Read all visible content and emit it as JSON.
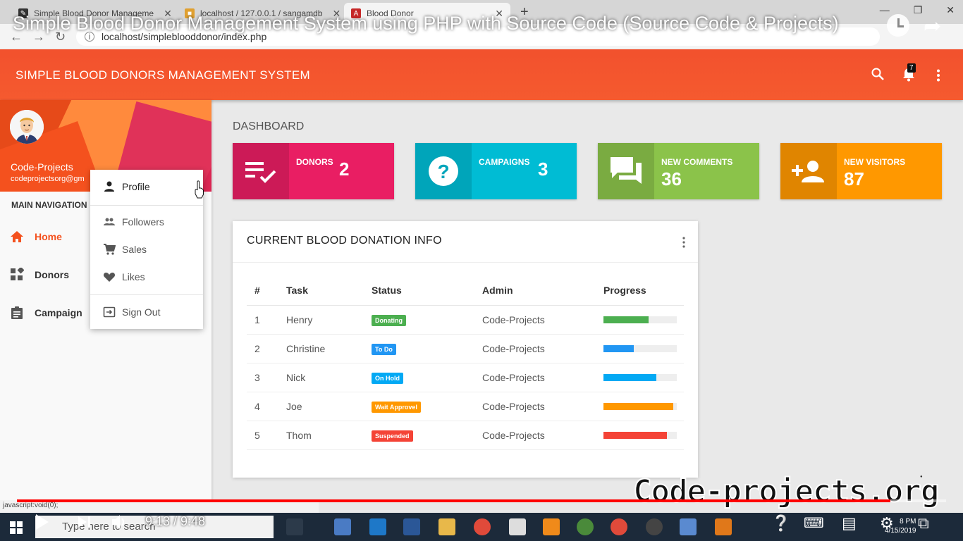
{
  "browser": {
    "tabs": [
      {
        "title": "Simple Blood Donor Manageme",
        "icon": "video-icon"
      },
      {
        "title": "localhost / 127.0.0.1 / sangamdb",
        "icon": "db-icon"
      },
      {
        "title": "Blood Donor",
        "icon": "app-icon"
      }
    ],
    "url": "localhost/simpleblooddonor/index.php"
  },
  "video": {
    "title": "Simple Blood Donor Management System using PHP with Source Code (Source Code & Projects)",
    "time": "9:13 / 9:48",
    "progress_fraction": 0.94
  },
  "app": {
    "title": "SIMPLE BLOOD DONORS MANAGEMENT SYSTEM",
    "notification_count": "7"
  },
  "sidebar": {
    "user_name": "Code-Projects",
    "user_email": "codeprojectsorg@gm",
    "nav_header": "MAIN NAVIGATION",
    "items": [
      {
        "label": "Home",
        "icon": "home-icon",
        "active": true
      },
      {
        "label": "Donors",
        "icon": "widgets-icon"
      },
      {
        "label": "Campaign",
        "icon": "assignment-icon"
      }
    ]
  },
  "dropdown": {
    "items": [
      {
        "label": "Profile",
        "icon": "person-icon"
      },
      {
        "label": "Followers",
        "icon": "group-icon"
      },
      {
        "label": "Sales",
        "icon": "cart-icon"
      },
      {
        "label": "Likes",
        "icon": "heart-icon"
      },
      {
        "label": "Sign Out",
        "icon": "sign-out-icon"
      }
    ]
  },
  "dashboard": {
    "title": "DASHBOARD",
    "boxes": [
      {
        "label": "DONORS",
        "value": "2",
        "color": "#e91e63"
      },
      {
        "label": "CAMPAIGNS",
        "value": "3",
        "color": "#00bcd4"
      },
      {
        "label": "NEW COMMENTS",
        "value": "36",
        "color": "#8bc34a"
      },
      {
        "label": "NEW VISITORS",
        "value": "87",
        "color": "#ff9800"
      }
    ]
  },
  "table": {
    "title": "CURRENT BLOOD DONATION INFO",
    "headers": [
      "#",
      "Task",
      "Status",
      "Admin",
      "Progress"
    ],
    "rows": [
      {
        "num": "1",
        "task": "Henry",
        "status": "Donating",
        "status_color": "#4caf50",
        "admin": "Code-Projects",
        "progress": 62,
        "bar_color": "#4caf50"
      },
      {
        "num": "2",
        "task": "Christine",
        "status": "To Do",
        "status_color": "#2196f3",
        "admin": "Code-Projects",
        "progress": 41,
        "bar_color": "#2196f3"
      },
      {
        "num": "3",
        "task": "Nick",
        "status": "On Hold",
        "status_color": "#03a9f4",
        "admin": "Code-Projects",
        "progress": 72,
        "bar_color": "#03a9f4"
      },
      {
        "num": "4",
        "task": "Joe",
        "status": "Wait Approvel",
        "status_color": "#ff9800",
        "admin": "Code-Projects",
        "progress": 95,
        "bar_color": "#ff9800"
      },
      {
        "num": "5",
        "task": "Thom",
        "status": "Suspended",
        "status_color": "#f44336",
        "admin": "Code-Projects",
        "progress": 87,
        "bar_color": "#f44336"
      }
    ]
  },
  "watermark": "Code-projects.org",
  "statusbar": "javascript:void(0);",
  "taskbar": {
    "search_placeholder": "Type here to search",
    "time": "8 PM",
    "date": "4/15/2019"
  }
}
